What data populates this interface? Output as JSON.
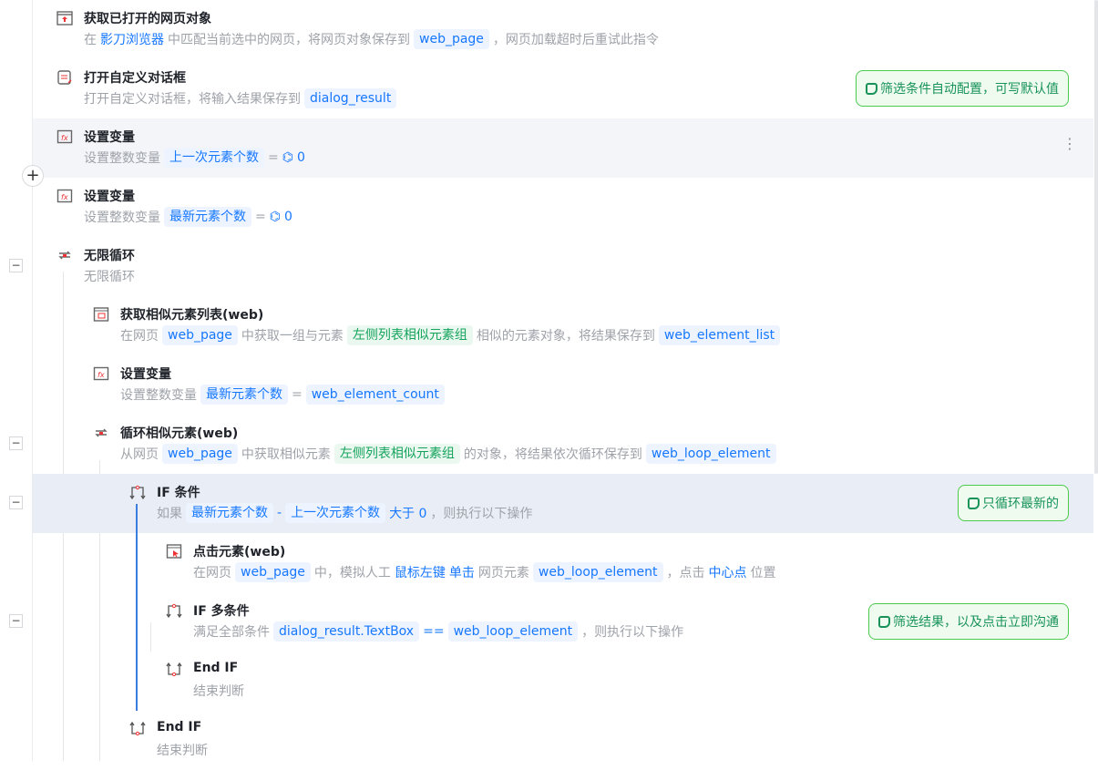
{
  "steps": [
    {
      "title": "获取已打开的网页对象",
      "desc": [
        "在",
        "影刀浏览器",
        "中匹配当前选中的网页，将网页对象保存到",
        "web_page",
        "，网页加载超时后重试此指令"
      ]
    },
    {
      "title": "打开自定义对话框",
      "desc": [
        "打开自定义对话框，将输入结果保存到",
        "dialog_result"
      ],
      "note": "筛选条件自动配置，可写默认值"
    },
    {
      "title": "设置变量",
      "desc": [
        "设置整数变量",
        "上一次元素个数",
        "=",
        "0"
      ]
    },
    {
      "title": "设置变量",
      "desc": [
        "设置整数变量",
        "最新元素个数",
        "=",
        "0"
      ]
    },
    {
      "title": "无限循环",
      "desc": [
        "无限循环"
      ]
    },
    {
      "title": "获取相似元素列表(web)",
      "desc": [
        "在网页",
        "web_page",
        "中获取一组与元素",
        "左侧列表相似元素组",
        "相似的元素对象，将结果保存到",
        "web_element_list"
      ]
    },
    {
      "title": "设置变量",
      "desc": [
        "设置整数变量",
        "最新元素个数",
        "=",
        "web_element_count"
      ]
    },
    {
      "title": "循环相似元素(web)",
      "desc": [
        "从网页",
        "web_page",
        "中获取相似元素",
        "左侧列表相似元素组",
        "的对象，将结果依次循环保存到",
        "web_loop_element"
      ]
    },
    {
      "title": "IF 条件",
      "desc": [
        "如果",
        "最新元素个数",
        "-",
        "上一次元素个数",
        "大于 0",
        "，则执行以下操作"
      ],
      "note": "只循环最新的"
    },
    {
      "title": "点击元素(web)",
      "desc": [
        "在网页",
        "web_page",
        "中，模拟人工",
        "鼠标左键",
        "单击",
        "网页元素",
        "web_loop_element",
        "，点击",
        "中心点",
        "位置"
      ]
    },
    {
      "title": "IF 多条件",
      "desc": [
        "满足全部条件",
        "dialog_result.TextBox",
        "==",
        "web_loop_element",
        "，则执行以下操作"
      ],
      "note": "筛选结果，以及点击立即沟通"
    },
    {
      "title": "End IF",
      "desc": [
        "结束判断"
      ]
    },
    {
      "title": "End IF",
      "desc": [
        "结束判断"
      ]
    }
  ],
  "controls": {
    "add": "+",
    "collapse": "−",
    "more": "⋮"
  }
}
